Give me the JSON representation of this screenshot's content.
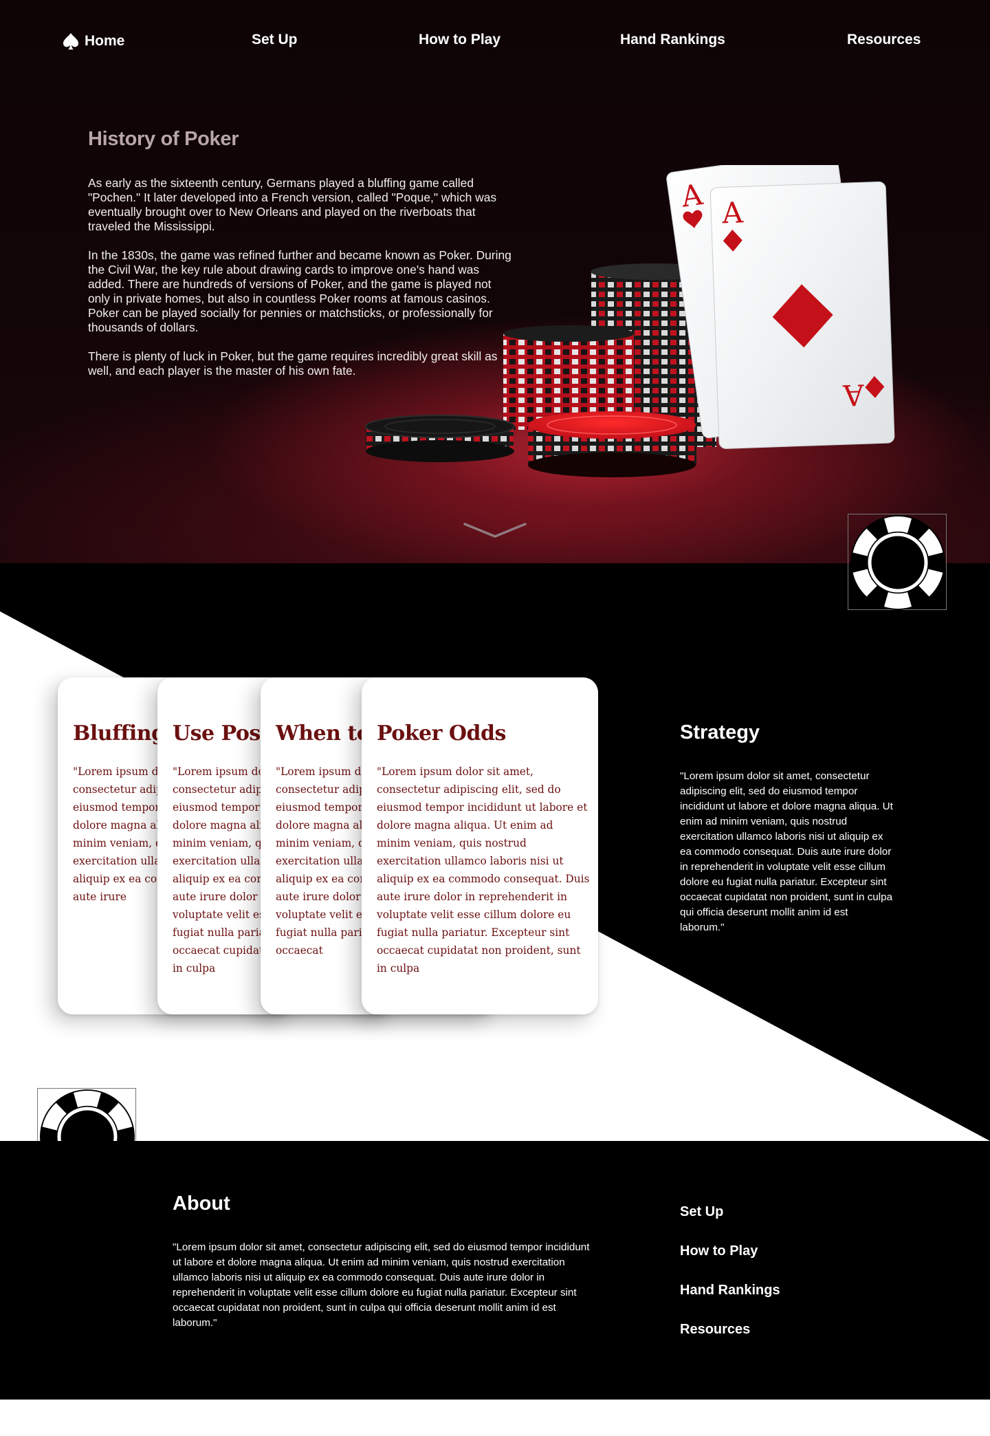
{
  "colors": {
    "hero_bg": "#120507",
    "felt_red": "#b02a38",
    "card_text": "#6b1010",
    "black": "#000000",
    "white": "#ffffff",
    "hero_title": "#b9a6a9"
  },
  "nav": {
    "items": [
      {
        "label": "Home",
        "icon": "spade-icon"
      },
      {
        "label": "Set Up"
      },
      {
        "label": "How to Play"
      },
      {
        "label": "Hand Rankings"
      },
      {
        "label": "Resources"
      }
    ]
  },
  "hero": {
    "title": "History of Poker",
    "paragraphs": [
      "As early as the sixteenth century, Germans played a bluffing game called \"Pochen.\" It later developed into a French version, called \"Poque,\" which was eventually brought over to New Orleans and played on the riverboats that traveled the Mississippi.",
      "In the 1830s, the game was refined further and became known as Poker. During the Civil War, the key rule about drawing cards to improve one's hand was added. There are hundreds of versions of Poker, and the game is played not only in private homes, but also in countless Poker rooms at famous casinos. Poker can be played socially for pennies or matchsticks, or professionally for thousands of dollars.",
      "There is plenty of luck in Poker, but the game requires incredibly great skill as well, and each player is the master of his own fate."
    ],
    "image_icon": "poker-chips-and-aces-illustration",
    "scroll_icon": "chevron-down-icon"
  },
  "cards": [
    {
      "title": "Bluffing",
      "body": "\"Lorem ipsum dolor sit amet, consectetur adipiscing elit, sed do eiusmod tempor incididunt ut labore et dolore magna aliqua. Ut enim ad minim veniam, quis nostrud exercitation ullamco laboris nisi ut aliquip ex ea commodo consequat. Duis aute irure"
    },
    {
      "title": "Use Position",
      "body": "\"Lorem ipsum dolor sit amet, consectetur adipiscing elit, sed do eiusmod tempor incididunt ut labore et dolore magna aliqua. Ut enim ad minim veniam, quis nostrud exercitation ullamco laboris nisi ut aliquip ex ea commodo consequat. Duis aute irure dolor in reprehenderit in voluptate velit esse cillum dolore eu fugiat nulla pariatur. Excepteur sint occaecat cupidatat non proident, sunt in culpa"
    },
    {
      "title": "When to Fold",
      "body": "\"Lorem ipsum dolor sit amet, consectetur adipiscing elit, sed do eiusmod tempor incididunt ut labore et dolore magna aliqua. Ut enim ad minim veniam, quis nostrud exercitation ullamco laboris nisi ut aliquip ex ea commodo consequat. Duis aute irure dolor in reprehenderit in voluptate velit esse cillum dolore eu fugiat nulla pariatur. Excepteur sint occaecat"
    },
    {
      "title": "Poker Odds",
      "body": "\"Lorem ipsum dolor sit amet, consectetur adipiscing elit, sed do eiusmod tempor incididunt ut labore et dolore magna aliqua. Ut enim ad minim veniam, quis nostrud exercitation ullamco laboris nisi ut aliquip ex ea commodo consequat. Duis aute irure dolor in reprehenderit in voluptate velit esse cillum dolore eu fugiat nulla pariatur. Excepteur sint occaecat cupidatat non proident, sunt in culpa"
    }
  ],
  "strategy": {
    "title": "Strategy",
    "body": "\"Lorem ipsum dolor sit amet, consectetur adipiscing elit, sed do eiusmod tempor incididunt ut labore et dolore magna aliqua. Ut enim ad minim veniam, quis nostrud exercitation ullamco laboris nisi ut aliquip ex ea commodo consequat. Duis aute irure dolor in reprehenderit in voluptate velit esse cillum dolore eu fugiat nulla pariatur. Excepteur sint occaecat cupidatat non proident, sunt in culpa qui officia deserunt mollit anim id est laborum.\""
  },
  "about": {
    "title": "About",
    "body": "\"Lorem ipsum dolor sit amet, consectetur adipiscing elit, sed do eiusmod tempor incididunt ut labore et dolore magna aliqua. Ut enim ad minim veniam, quis nostrud exercitation ullamco laboris nisi ut aliquip ex ea commodo consequat. Duis aute irure dolor in reprehenderit in voluptate velit esse cillum dolore eu fugiat nulla pariatur. Excepteur sint occaecat cupidatat non proident, sunt in culpa qui officia deserunt mollit anim id est laborum.\""
  },
  "footer_links": [
    "Set Up",
    "How to Play",
    "Hand Rankings",
    "Resources"
  ],
  "chip_icons": [
    "poker-chip-icon",
    "poker-chip-icon"
  ]
}
